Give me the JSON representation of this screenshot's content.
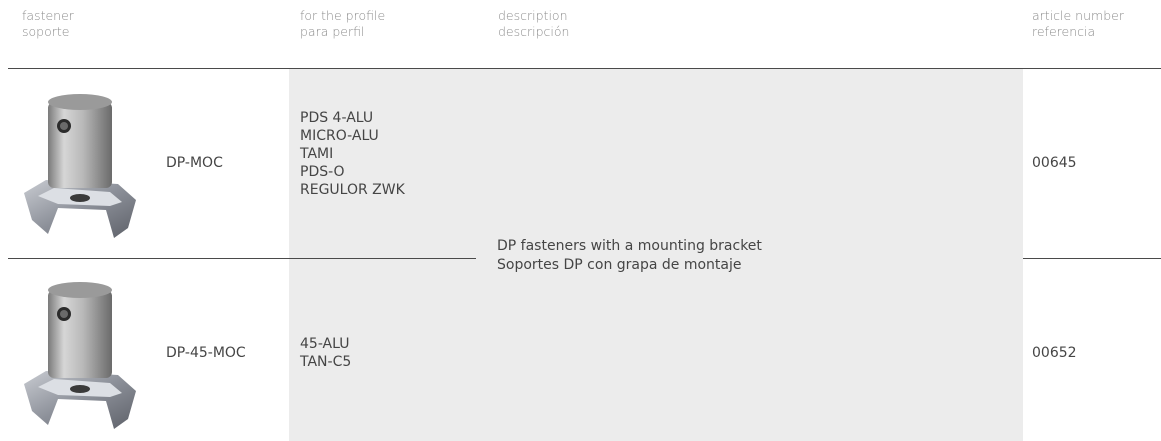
{
  "headers": {
    "fastener": {
      "en": "fastener",
      "es": "soporte"
    },
    "profile": {
      "en": "for the profile",
      "es": "para perfil"
    },
    "description": {
      "en": "description",
      "es": "descripción"
    },
    "article": {
      "en": "article number",
      "es": "referencia"
    }
  },
  "rows": [
    {
      "model": "DP-MOC",
      "profiles": [
        "PDS 4-ALU",
        "MICRO-ALU",
        "TAMI",
        "PDS-O",
        "REGULOR ZWK"
      ],
      "article": "00645"
    },
    {
      "model": "DP-45-MOC",
      "profiles": [
        "45-ALU",
        "TAN-C5"
      ],
      "article": "00652"
    }
  ],
  "description": {
    "en": "DP fasteners with a mounting bracket",
    "es": "Soportes DP con grapa de montaje"
  }
}
